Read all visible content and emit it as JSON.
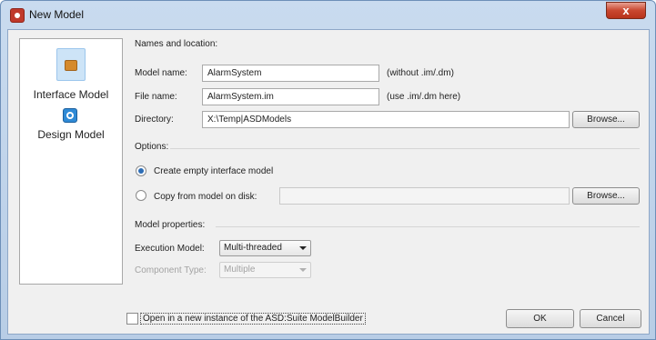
{
  "window": {
    "title": "New Model",
    "close_glyph": "x"
  },
  "model_list": [
    {
      "label": "Interface Model",
      "icon": "interface-model-icon",
      "selected": true
    },
    {
      "label": "Design Model",
      "icon": "design-model-icon",
      "selected": false
    }
  ],
  "names": {
    "header": "Names and location:",
    "model_name_label": "Model name:",
    "model_name_value": "AlarmSystem",
    "model_name_hint": "(without .im/.dm)",
    "file_name_label": "File name:",
    "file_name_value": "AlarmSystem.im",
    "file_name_hint": "(use .im/.dm here)",
    "directory_label": "Directory:",
    "directory_value": "X:\\Temp|ASDModels",
    "browse_label": "Browse..."
  },
  "options": {
    "header": "Options:",
    "create_empty_label": "Create empty interface model",
    "copy_from_label": "Copy from model on disk:",
    "copy_from_value": "",
    "browse_label": "Browse...",
    "selected": "create_empty"
  },
  "properties": {
    "header": "Model properties:",
    "execution_model_label": "Execution Model:",
    "execution_model_value": "Multi-threaded",
    "component_type_label": "Component Type:",
    "component_type_value": "Multiple"
  },
  "footer": {
    "open_new_instance_label": "Open in a new instance of the ASD:Suite ModelBuilder",
    "open_new_instance_checked": false,
    "ok_label": "OK",
    "cancel_label": "Cancel"
  }
}
